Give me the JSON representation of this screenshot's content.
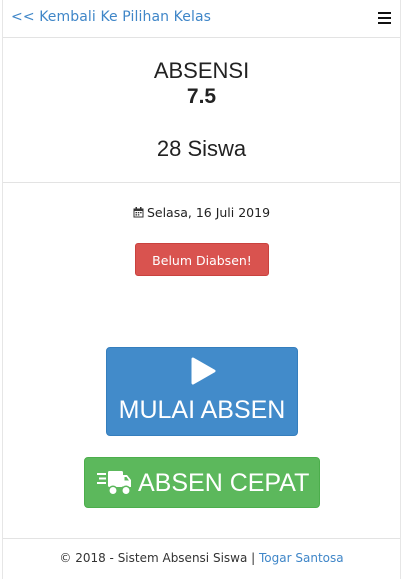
{
  "nav": {
    "back_label": "<< Kembali Ke Pilihan Kelas",
    "menu_icon": "hamburger-menu-icon"
  },
  "main": {
    "title": "ABSENSI",
    "class_code": "7.5",
    "student_count": "28 Siswa",
    "date": "Selasa, 16 Juli 2019",
    "date_icon": "calendar-icon",
    "status_badge": "Belum Diabsen!"
  },
  "actions": {
    "start_label": "MULAI ABSEN",
    "start_icon": "play-icon",
    "quick_label": "ABSEN CEPAT",
    "quick_icon": "truck-fast-icon"
  },
  "footer": {
    "copyright": "© 2018 - Sistem Absensi Siswa |",
    "author": "Togar Santosa"
  },
  "colors": {
    "link": "#3f86c8",
    "danger": "#d9534f",
    "primary": "#428bca",
    "success": "#5cb85c"
  }
}
